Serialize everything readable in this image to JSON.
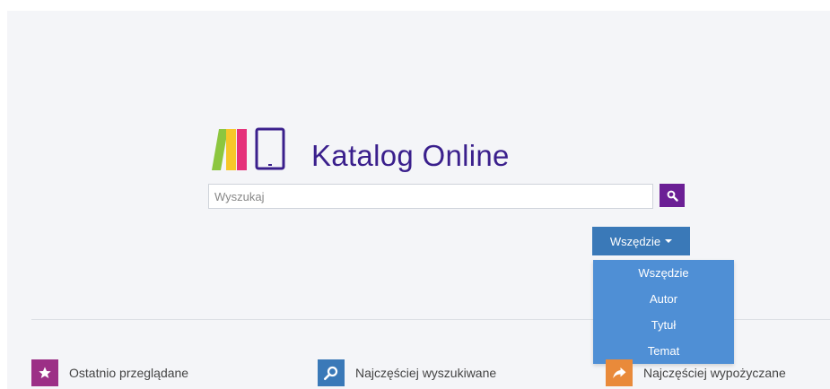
{
  "header": {
    "title": "Katalog Online"
  },
  "search": {
    "placeholder": "Wyszukaj",
    "button_icon": "search-icon"
  },
  "scope": {
    "selected": "Wszędzie",
    "options": [
      "Wszędzie",
      "Autor",
      "Tytuł",
      "Temat"
    ]
  },
  "bottom_links": [
    {
      "label": "Ostatnio przeglądane",
      "icon": "star-icon",
      "color": "#9c2f86"
    },
    {
      "label": "Najczęściej wyszukiwane",
      "icon": "search-icon",
      "color": "#3a79b8"
    },
    {
      "label": "Najczęściej wypożyczane",
      "icon": "share-arrow-icon",
      "color": "#e98a3a"
    }
  ],
  "colors": {
    "brand_purple": "#3a1f8c",
    "search_button": "#6b1f95",
    "dropdown_blue": "#4f8fd5",
    "scope_button": "#3a79b8",
    "logo_green": "#8cc63f",
    "logo_yellow": "#f7c629",
    "logo_red": "#e5307a",
    "logo_purple": "#3a1f8c"
  }
}
